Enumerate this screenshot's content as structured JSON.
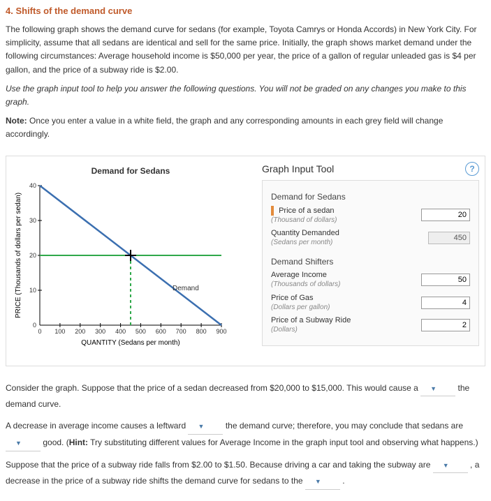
{
  "heading": "4. Shifts of the demand curve",
  "intro": "The following graph shows the demand curve for sedans (for example, Toyota Camrys or Honda Accords) in New York City. For simplicity, assume that all sedans are identical and sell for the same price. Initially, the graph shows market demand under the following circumstances: Average household income is $50,000 per year, the price of a gallon of regular unleaded gas is $4 per gallon, and the price of a subway ride is $2.00.",
  "instruction": "Use the graph input tool to help you answer the following questions. You will not be graded on any changes you make to this graph.",
  "note_label": "Note:",
  "note_text": " Once you enter a value in a white field, the graph and any corresponding amounts in each grey field will change accordingly.",
  "chart": {
    "title": "Demand for Sedans",
    "xlabel": "QUANTITY (Sedans per month)",
    "ylabel": "PRICE (Thousands of dollars per sedan)",
    "line_label": "Demand"
  },
  "chart_data": {
    "type": "line",
    "title": "Demand for Sedans",
    "xlabel": "QUANTITY (Sedans per month)",
    "ylabel": "PRICE (Thousands of dollars per sedan)",
    "xlim": [
      0,
      900
    ],
    "ylim": [
      0,
      40
    ],
    "xticks": [
      0,
      100,
      200,
      300,
      400,
      500,
      600,
      700,
      800,
      900
    ],
    "yticks": [
      0,
      10,
      20,
      30,
      40
    ],
    "series": [
      {
        "name": "Demand",
        "color": "#3b6fb0",
        "x": [
          0,
          900
        ],
        "y": [
          40,
          0
        ]
      }
    ],
    "guides": {
      "horizontal": {
        "y": 20,
        "color": "#2fa84a"
      },
      "vertical": {
        "x": 450,
        "color": "#2fa84a",
        "style": "dashed"
      },
      "intersection": {
        "x": 450,
        "y": 20
      }
    }
  },
  "tool": {
    "header": "Graph Input Tool",
    "section1": "Demand for Sedans",
    "price_label": "Price of a sedan",
    "price_sub": "(Thousand of dollars)",
    "price_value": "20",
    "qty_label": "Quantity Demanded",
    "qty_sub": "(Sedans per month)",
    "qty_value": "450",
    "section2": "Demand Shifters",
    "income_label": "Average Income",
    "income_sub": "(Thousands of dollars)",
    "income_value": "50",
    "gas_label": "Price of Gas",
    "gas_sub": "(Dollars per gallon)",
    "gas_value": "4",
    "subway_label": "Price of a Subway Ride",
    "subway_sub": "(Dollars)",
    "subway_value": "2"
  },
  "q1a": "Consider the graph. Suppose that the price of a sedan decreased from $20,000 to $15,000. This would cause a ",
  "q1b": " the demand curve.",
  "q2a": "A decrease in average income causes a leftward ",
  "q2b": " the demand curve; therefore, you may conclude that sedans are ",
  "q2c": " good. (",
  "q2hint_label": "Hint:",
  "q2hint": " Try substituting different values for Average Income in the graph input tool and observing what happens.)",
  "q3a": "Suppose that the price of a subway ride falls from $2.00 to $1.50. Because driving a car and taking the subway are ",
  "q3b": " , a decrease in the price of a subway ride shifts the demand curve for sedans to the ",
  "q3c": " ."
}
